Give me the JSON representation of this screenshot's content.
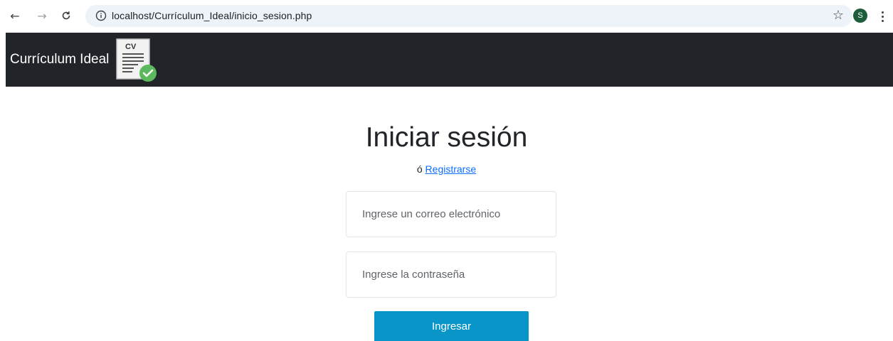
{
  "browser": {
    "back_icon": "←",
    "forward_icon": "→",
    "reload_icon": "C",
    "url": "localhost/Currículum_Ideal/inicio_sesion.php",
    "star_icon": "☆",
    "profile_initial": "S"
  },
  "header": {
    "brand": "Currículum Ideal",
    "logo_text": "CV"
  },
  "main": {
    "title": "Iniciar sesión",
    "alt_prefix": "ó",
    "register_link": "Registrarse",
    "email_placeholder": "Ingrese un correo electrónico",
    "password_placeholder": "Ingrese la contraseña",
    "submit_label": "Ingresar"
  },
  "colors": {
    "header_bg": "#212529",
    "link": "#0d6efd",
    "button": "#0a95c9",
    "check_badge": "#5cb85c"
  }
}
